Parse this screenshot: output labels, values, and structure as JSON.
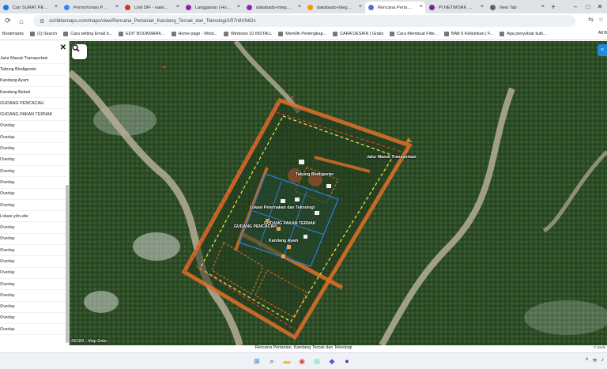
{
  "tabs": [
    {
      "label": "Cari SURAT PERMOHON",
      "color": "#1a73e8"
    },
    {
      "label": "Permohonan Penerbitan",
      "color": "#4285f4"
    },
    {
      "label": "Link DIF - nawipayer",
      "color": "#d93025"
    },
    {
      "label": "Langganan | Hosting",
      "color": "#8e24aa"
    },
    {
      "label": "dakabado-integrated",
      "color": "#8e24aa"
    },
    {
      "label": "dakabado-integrated",
      "color": "#f29900"
    },
    {
      "label": "Rencana Pertanian, K",
      "color": "#5b6cc9",
      "active": true
    },
    {
      "label": "PI NETWORK & GOO",
      "color": "#7b1fa2"
    },
    {
      "label": "New Tab",
      "color": "#5f6368"
    }
  ],
  "address": {
    "url": "scribblemaps.com/maps/view/Rencana_Pertanian_Kandang_Ternak_dan_Teknologi/1R7n8VN62x"
  },
  "bookmarks": {
    "label": "Bookmarks",
    "items": [
      "(1) Search",
      "Cara setting Email d...",
      "EDIT BOOKMARK...",
      "Home page - Wind...",
      "Windows 10 INSTALL",
      "Memilih Perlengkap...",
      "CARA DESAIN | Gratis",
      "Cara Membuat Filte...",
      "BAB 6 Kelistrikan | F...",
      "Apa penyebab kulk..."
    ],
    "all": "All B"
  },
  "sidebar": {
    "items": [
      "Jalur Masuk Transportasi",
      "Tabung Biodigester",
      "Kandang Ayam",
      "Kandang Bebek",
      "GUDANG PENCACAH",
      "GUDANG PAKAN TERNAK",
      "Overlay",
      "Overlay",
      "Overlay",
      "Overlay",
      "Overlay",
      "Overlay",
      "Overlay",
      "Overlay",
      "Lokasi y4n.site",
      "Overlay",
      "Overlay",
      "Overlay",
      "Overlay",
      "Overlay",
      "Overlay",
      "Overlay",
      "Overlay",
      "Overlay",
      "Overlay"
    ]
  },
  "map": {
    "labels": {
      "jalur": "Jalur Masuk Transportasi",
      "biodigester": "Tabung Biodigester",
      "lokasi": "Lokasi Peternakan dan Teknologi",
      "gudang_pakan": "GUDANG PAKAN TERNAK",
      "gudang_pencacah": "GUDANG PENCACAH",
      "kandang_ayam": "Kandang Ayam"
    },
    "attribution": "©ESRI · Map Data",
    "caption": "Rencana Pertanian, Kandang Ternak dan Teknologi",
    "caption_right": "© Scrib"
  },
  "colors": {
    "boundary": "#e0702a",
    "dash_yellow": "#f1e94a",
    "dash_red": "#e23a2a",
    "plot": "#2f7bd6"
  }
}
